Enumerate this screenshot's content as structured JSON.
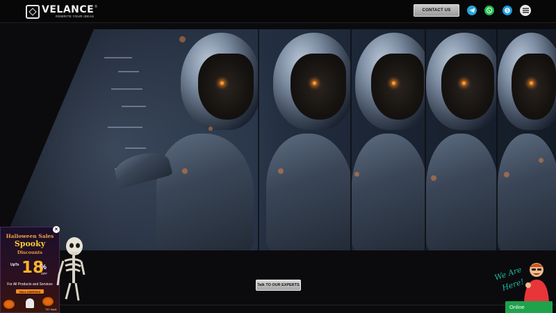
{
  "header": {
    "logo": {
      "name": "VELANCE",
      "tagline": "REWRITE YOUR IDEAS",
      "trademark": "®"
    },
    "contact_label": "CONTACT US",
    "social": [
      {
        "icon": "telegram-icon",
        "color": "#2aa3d8"
      },
      {
        "icon": "whatsapp-icon",
        "color": "#1ebc4f"
      },
      {
        "icon": "skype-icon",
        "color": "#1b9be0"
      },
      {
        "icon": "menu-icon",
        "color": "#e9e9e9"
      }
    ]
  },
  "hero": {
    "image": "robot-server-room",
    "cta_label": "Talk TO OUR EXPERTS"
  },
  "promo": {
    "line1": "Halloween Sales",
    "line2": "Spooky",
    "line3": "Discounts",
    "upto": "UpTo",
    "percent": "18",
    "percent_sign": "%",
    "off": "OFF",
    "for_text": "For All Products and Services",
    "code_label": "HALLOWEEN18",
    "tc": "T&C Apply",
    "close_label": "×"
  },
  "chat": {
    "line1": "We Are",
    "line2": "Here!",
    "status": "Online",
    "status_color": "#1ea24b"
  },
  "colors": {
    "background": "#0b0b0d",
    "accent_orange": "#ffb429",
    "chat_teal": "#1fb7a0"
  }
}
